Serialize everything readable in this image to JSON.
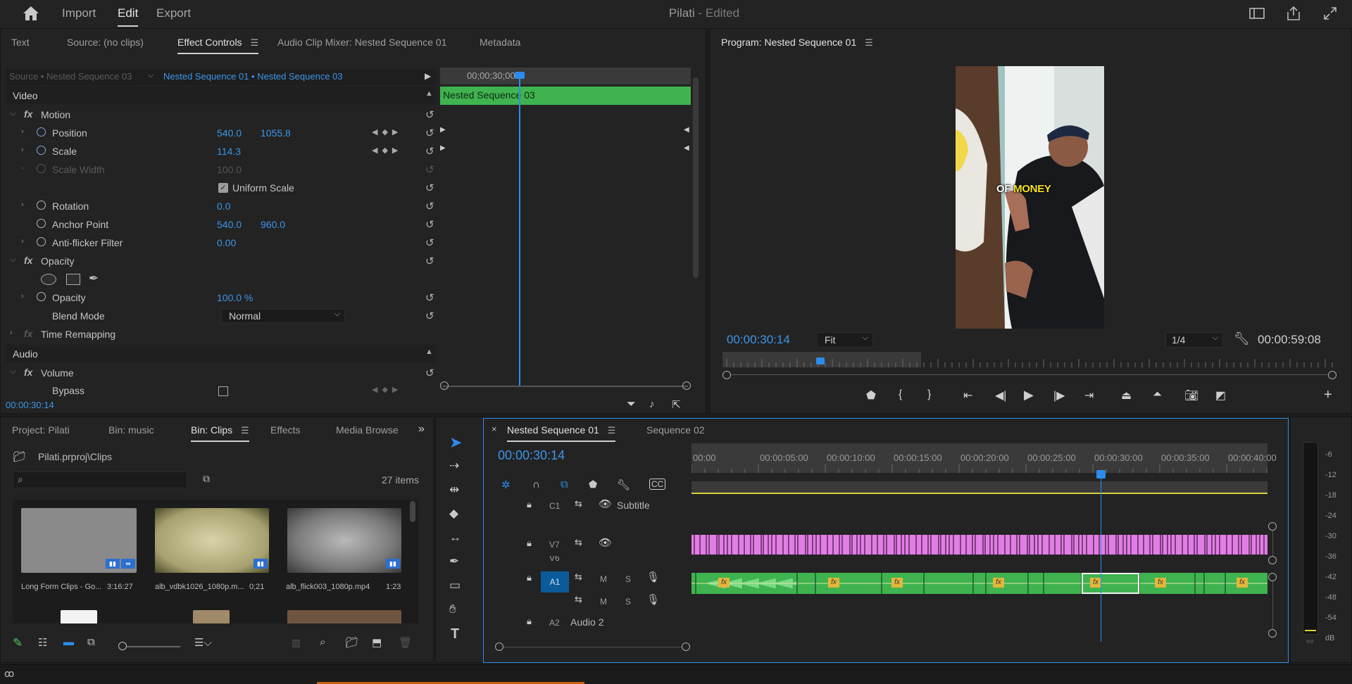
{
  "topbar": {
    "nav": [
      "Import",
      "Edit",
      "Export"
    ],
    "active": "Edit",
    "title": "Pilati",
    "title_status": "- Edited"
  },
  "source_panel": {
    "tabs": [
      "Text",
      "Source: (no clips)",
      "Effect Controls",
      "Audio Clip Mixer: Nested Sequence 01",
      "Metadata"
    ],
    "active_tab": "Effect Controls",
    "source_crumb": "Source • Nested Sequence 03",
    "sequence_crumb": "Nested Sequence 01 • Nested Sequence 03",
    "mini_time": "00;00;30;00",
    "clip_name": "Nested Sequence 03",
    "timecode": "00:00:30:14",
    "sections": {
      "video": "Video",
      "audio": "Audio"
    },
    "motion": {
      "label": "Motion",
      "position": {
        "label": "Position",
        "x": "540.0",
        "y": "1055.8"
      },
      "scale": {
        "label": "Scale",
        "value": "114.3"
      },
      "scale_width": {
        "label": "Scale Width",
        "value": "100.0"
      },
      "uniform_scale": "Uniform Scale",
      "rotation": {
        "label": "Rotation",
        "value": "0.0"
      },
      "anchor": {
        "label": "Anchor Point",
        "x": "540.0",
        "y": "960.0"
      },
      "antiflicker": {
        "label": "Anti-flicker Filter",
        "value": "0.00"
      }
    },
    "opacity": {
      "label": "Opacity",
      "value_label": "Opacity",
      "value": "100.0 %",
      "blend_label": "Blend Mode",
      "blend_value": "Normal"
    },
    "time_remap": "Time Remapping",
    "volume": {
      "label": "Volume",
      "bypass": "Bypass"
    }
  },
  "program_monitor": {
    "title": "Program: Nested Sequence 01",
    "caption_white": "OF",
    "caption_yellow": "MONEY",
    "timecode": "00:00:30:14",
    "fit": "Fit",
    "resolution": "1/4",
    "duration": "00:00:59:08",
    "playhead_position": 0.3
  },
  "project_panel": {
    "tabs": [
      "Project: Pilati",
      "Bin: music",
      "Bin: Clips",
      "Effects",
      "Media Browse"
    ],
    "active_tab": "Bin: Clips",
    "path": "Pilati.prproj\\Clips",
    "items_count": "27 items",
    "clips": [
      {
        "name": "Long Form Clips - Go...",
        "duration": "3:16:27"
      },
      {
        "name": "alb_vdbk1026_1080p.m...",
        "duration": "0;21"
      },
      {
        "name": "alb_flick003_1080p.mp4",
        "duration": "1:23"
      }
    ]
  },
  "timeline": {
    "tabs": [
      "Nested Sequence 01",
      "Sequence 02"
    ],
    "active_tab": "Nested Sequence 01",
    "timecode": "00:00:30:14",
    "ruler": [
      "00:00",
      "00:00:05:00",
      "00:00:10:00",
      "00:00:15:00",
      "00:00:20:00",
      "00:00:25:00",
      "00:00:30:00",
      "00:00:35:00",
      "00:00:40:00"
    ],
    "tracks": {
      "c1": {
        "name": "C1",
        "label": "Subtitle"
      },
      "v7": {
        "name": "V7"
      },
      "v6": {
        "name": "V6"
      },
      "a1": {
        "name": "A1",
        "m": "M",
        "s": "S"
      },
      "a2": {
        "name": "A2",
        "m": "M",
        "s": "S",
        "label": "Audio 2"
      }
    }
  },
  "meter": {
    "labels": [
      "-6",
      "-12",
      "-18",
      "-24",
      "-30",
      "-36",
      "-42",
      "-48",
      "-54",
      "dB"
    ]
  },
  "colors": {
    "accent": "#2d8ceb",
    "clip_green": "#3fb34f",
    "clip_pink": "#e17ee4",
    "fx_badge": "#e4b63b",
    "caption_yellow": "#f7e21e"
  }
}
